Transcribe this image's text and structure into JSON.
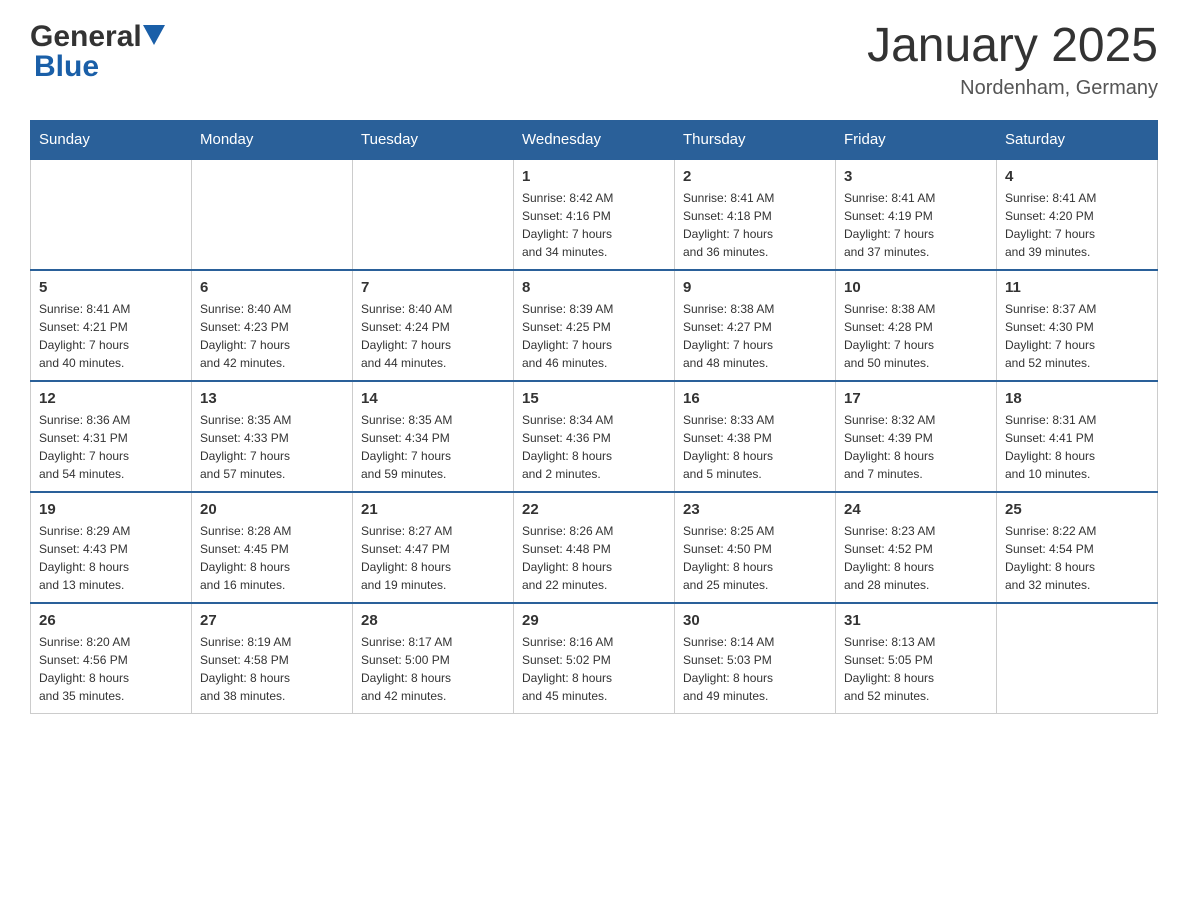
{
  "header": {
    "logo_general": "General",
    "logo_blue": "Blue",
    "month_title": "January 2025",
    "location": "Nordenham, Germany"
  },
  "days_of_week": [
    "Sunday",
    "Monday",
    "Tuesday",
    "Wednesday",
    "Thursday",
    "Friday",
    "Saturday"
  ],
  "weeks": [
    [
      {
        "day": "",
        "info": ""
      },
      {
        "day": "",
        "info": ""
      },
      {
        "day": "",
        "info": ""
      },
      {
        "day": "1",
        "info": "Sunrise: 8:42 AM\nSunset: 4:16 PM\nDaylight: 7 hours\nand 34 minutes."
      },
      {
        "day": "2",
        "info": "Sunrise: 8:41 AM\nSunset: 4:18 PM\nDaylight: 7 hours\nand 36 minutes."
      },
      {
        "day": "3",
        "info": "Sunrise: 8:41 AM\nSunset: 4:19 PM\nDaylight: 7 hours\nand 37 minutes."
      },
      {
        "day": "4",
        "info": "Sunrise: 8:41 AM\nSunset: 4:20 PM\nDaylight: 7 hours\nand 39 minutes."
      }
    ],
    [
      {
        "day": "5",
        "info": "Sunrise: 8:41 AM\nSunset: 4:21 PM\nDaylight: 7 hours\nand 40 minutes."
      },
      {
        "day": "6",
        "info": "Sunrise: 8:40 AM\nSunset: 4:23 PM\nDaylight: 7 hours\nand 42 minutes."
      },
      {
        "day": "7",
        "info": "Sunrise: 8:40 AM\nSunset: 4:24 PM\nDaylight: 7 hours\nand 44 minutes."
      },
      {
        "day": "8",
        "info": "Sunrise: 8:39 AM\nSunset: 4:25 PM\nDaylight: 7 hours\nand 46 minutes."
      },
      {
        "day": "9",
        "info": "Sunrise: 8:38 AM\nSunset: 4:27 PM\nDaylight: 7 hours\nand 48 minutes."
      },
      {
        "day": "10",
        "info": "Sunrise: 8:38 AM\nSunset: 4:28 PM\nDaylight: 7 hours\nand 50 minutes."
      },
      {
        "day": "11",
        "info": "Sunrise: 8:37 AM\nSunset: 4:30 PM\nDaylight: 7 hours\nand 52 minutes."
      }
    ],
    [
      {
        "day": "12",
        "info": "Sunrise: 8:36 AM\nSunset: 4:31 PM\nDaylight: 7 hours\nand 54 minutes."
      },
      {
        "day": "13",
        "info": "Sunrise: 8:35 AM\nSunset: 4:33 PM\nDaylight: 7 hours\nand 57 minutes."
      },
      {
        "day": "14",
        "info": "Sunrise: 8:35 AM\nSunset: 4:34 PM\nDaylight: 7 hours\nand 59 minutes."
      },
      {
        "day": "15",
        "info": "Sunrise: 8:34 AM\nSunset: 4:36 PM\nDaylight: 8 hours\nand 2 minutes."
      },
      {
        "day": "16",
        "info": "Sunrise: 8:33 AM\nSunset: 4:38 PM\nDaylight: 8 hours\nand 5 minutes."
      },
      {
        "day": "17",
        "info": "Sunrise: 8:32 AM\nSunset: 4:39 PM\nDaylight: 8 hours\nand 7 minutes."
      },
      {
        "day": "18",
        "info": "Sunrise: 8:31 AM\nSunset: 4:41 PM\nDaylight: 8 hours\nand 10 minutes."
      }
    ],
    [
      {
        "day": "19",
        "info": "Sunrise: 8:29 AM\nSunset: 4:43 PM\nDaylight: 8 hours\nand 13 minutes."
      },
      {
        "day": "20",
        "info": "Sunrise: 8:28 AM\nSunset: 4:45 PM\nDaylight: 8 hours\nand 16 minutes."
      },
      {
        "day": "21",
        "info": "Sunrise: 8:27 AM\nSunset: 4:47 PM\nDaylight: 8 hours\nand 19 minutes."
      },
      {
        "day": "22",
        "info": "Sunrise: 8:26 AM\nSunset: 4:48 PM\nDaylight: 8 hours\nand 22 minutes."
      },
      {
        "day": "23",
        "info": "Sunrise: 8:25 AM\nSunset: 4:50 PM\nDaylight: 8 hours\nand 25 minutes."
      },
      {
        "day": "24",
        "info": "Sunrise: 8:23 AM\nSunset: 4:52 PM\nDaylight: 8 hours\nand 28 minutes."
      },
      {
        "day": "25",
        "info": "Sunrise: 8:22 AM\nSunset: 4:54 PM\nDaylight: 8 hours\nand 32 minutes."
      }
    ],
    [
      {
        "day": "26",
        "info": "Sunrise: 8:20 AM\nSunset: 4:56 PM\nDaylight: 8 hours\nand 35 minutes."
      },
      {
        "day": "27",
        "info": "Sunrise: 8:19 AM\nSunset: 4:58 PM\nDaylight: 8 hours\nand 38 minutes."
      },
      {
        "day": "28",
        "info": "Sunrise: 8:17 AM\nSunset: 5:00 PM\nDaylight: 8 hours\nand 42 minutes."
      },
      {
        "day": "29",
        "info": "Sunrise: 8:16 AM\nSunset: 5:02 PM\nDaylight: 8 hours\nand 45 minutes."
      },
      {
        "day": "30",
        "info": "Sunrise: 8:14 AM\nSunset: 5:03 PM\nDaylight: 8 hours\nand 49 minutes."
      },
      {
        "day": "31",
        "info": "Sunrise: 8:13 AM\nSunset: 5:05 PM\nDaylight: 8 hours\nand 52 minutes."
      },
      {
        "day": "",
        "info": ""
      }
    ]
  ]
}
